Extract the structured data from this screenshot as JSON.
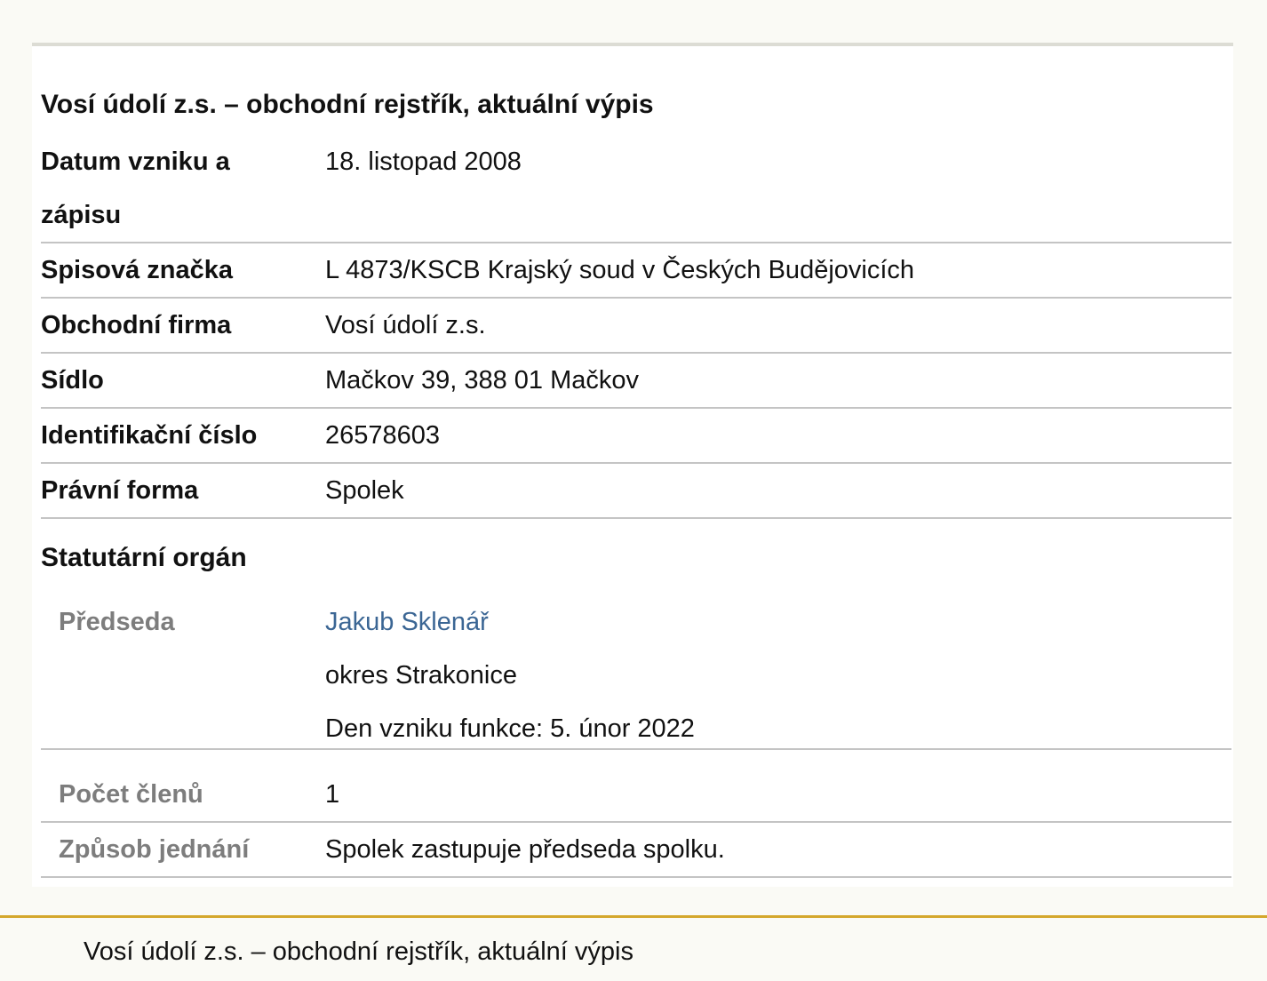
{
  "page": {
    "title": "Vosí údolí z.s. – obchodní rejstřík, aktuální výpis"
  },
  "rows": {
    "datum": {
      "label": "Datum vzniku a zápisu",
      "value": "18. listopad 2008"
    },
    "spisova": {
      "label": "Spisová značka",
      "value": "L 4873/KSCB Krajský soud v Českých Budějovicích"
    },
    "firma": {
      "label": "Obchodní firma",
      "value": "Vosí údolí z.s."
    },
    "sidlo": {
      "label": "Sídlo",
      "value": "Mačkov 39, 388 01 Mačkov"
    },
    "ico": {
      "label": "Identifikační číslo",
      "value": "26578603"
    },
    "forma": {
      "label": "Právní forma",
      "value": "Spolek"
    }
  },
  "statutarni": {
    "title": "Statutární orgán",
    "predseda": {
      "label": "Předseda",
      "name": "Jakub Sklenář",
      "district": "okres Strakonice",
      "since": "Den vzniku funkce: 5. únor 2022"
    },
    "pocet": {
      "label": "Počet členů",
      "value": "1"
    },
    "zpusob": {
      "label": "Způsob jednání",
      "value": "Spolek zastupuje předseda spolku."
    }
  },
  "footer": {
    "text": "Vosí údolí z.s. – obchodní rejstřík, aktuální výpis"
  },
  "colors": {
    "link": "#3b6694",
    "accent": "#d4a72c",
    "muted_label": "#7d7d7d"
  }
}
